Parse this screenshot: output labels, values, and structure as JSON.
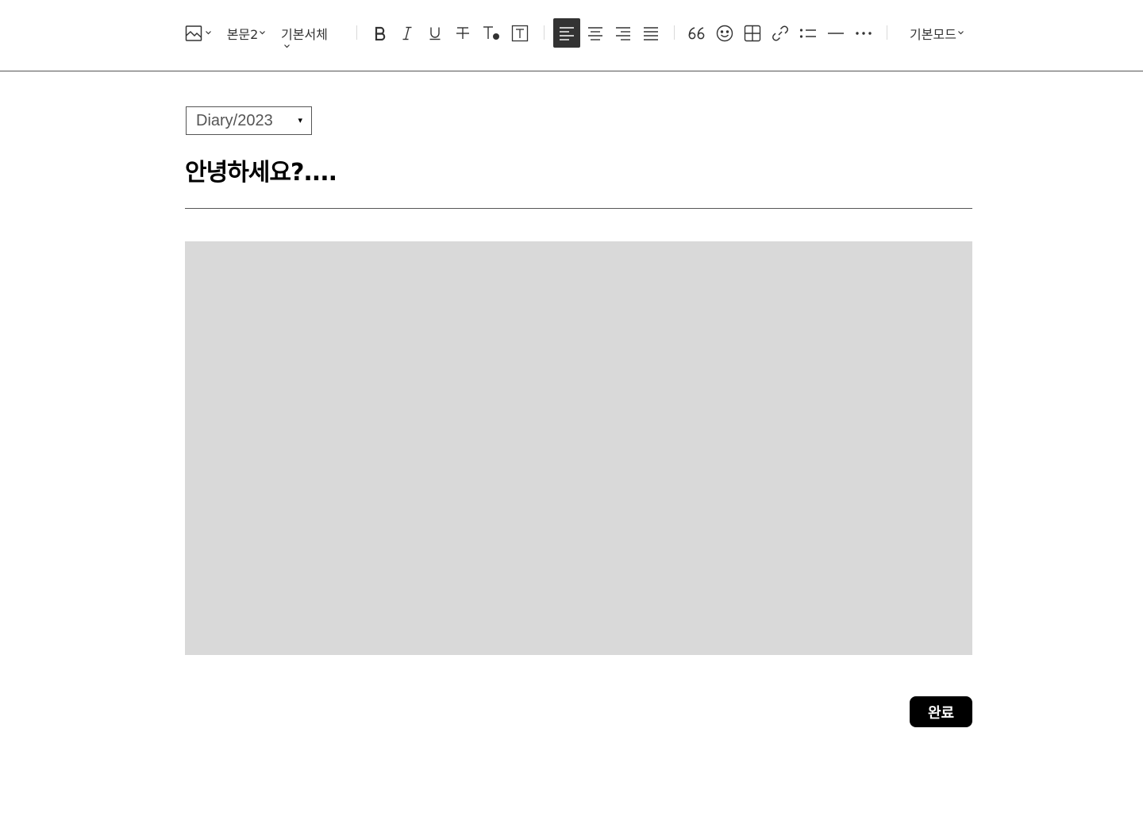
{
  "toolbar": {
    "paragraph_style": "본문2",
    "font_family": "기본서체",
    "mode": "기본모드",
    "alignment_active": "left",
    "icons": [
      "image-icon",
      "bold-icon",
      "italic-icon",
      "underline-icon",
      "strikethrough-icon",
      "text-color-icon",
      "text-background-icon",
      "align-left-icon",
      "align-center-icon",
      "align-right-icon",
      "align-justify-icon",
      "quote-icon",
      "emoticon-icon",
      "table-icon",
      "link-icon",
      "bulleted-list-icon",
      "horizontal-rule-icon",
      "more-icon"
    ]
  },
  "editor": {
    "category": "Diary/2023",
    "category_arrow": "▾",
    "title": "안녕하세요?....",
    "body_text": ""
  },
  "footer": {
    "done_label": "완료"
  },
  "colors": {
    "active_button": "#333333",
    "body_placeholder": "#d9d9d9",
    "done_button": "#000000"
  }
}
